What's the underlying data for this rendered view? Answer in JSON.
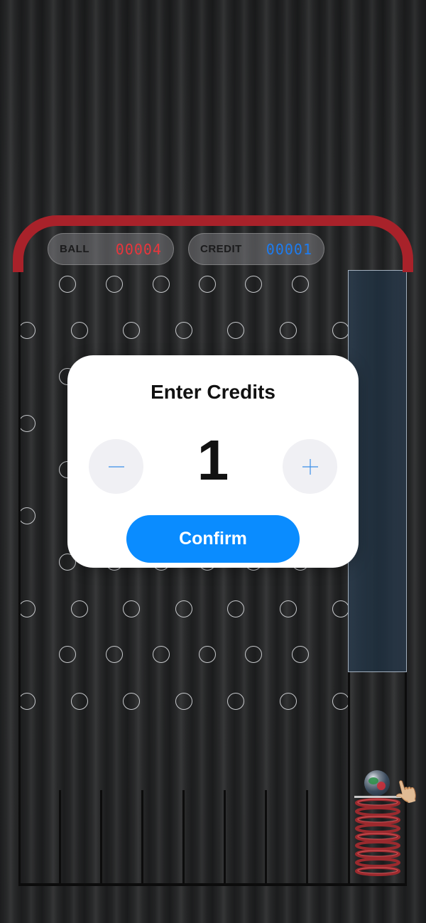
{
  "hud": {
    "ball_label": "BALL",
    "ball_value": "00004",
    "credit_label": "CREDIT",
    "credit_value": "00001"
  },
  "colors": {
    "arch": "#a8222a",
    "ball_value": "#e8363c",
    "credit_value": "#1d7cf0",
    "confirm_button": "#0a8cff"
  },
  "modal": {
    "title": "Enter Credits",
    "value": "1",
    "decrement_icon": "minus-icon",
    "increment_icon": "plus-icon",
    "confirm_label": "Confirm"
  },
  "icons": {
    "launcher_ball": "ball-icon",
    "launcher_hand": "pointing-hand-icon",
    "launcher_spring": "spring-icon"
  }
}
